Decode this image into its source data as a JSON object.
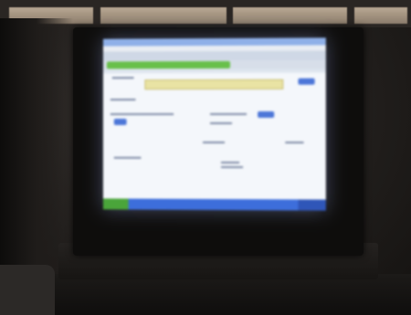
{
  "scene": {
    "description_items": {
      "room": "dark-room",
      "device": "monitor",
      "screen_app": "web-browser"
    },
    "colors": {
      "screen_glow": "#dfe6ef",
      "taskbar": "#3d6edb",
      "start_button": "#4aa53a",
      "highlight_bar": "#e9e3a4",
      "accent_button": "#4c76d8"
    }
  }
}
